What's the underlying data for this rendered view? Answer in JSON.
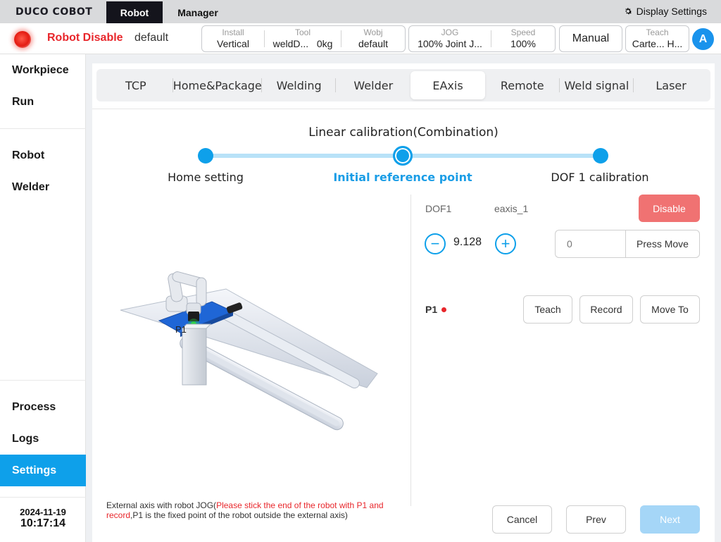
{
  "topbar": {
    "logo": "DUCO COBOT",
    "tabs": [
      "Robot",
      "Manager"
    ],
    "display_settings": "Display Settings"
  },
  "status": {
    "robot_state": "Robot Disable",
    "robot_name": "default",
    "install": {
      "label": "Install",
      "value": "Vertical"
    },
    "tool": {
      "label": "Tool",
      "value": "weldD...",
      "load": "0kg"
    },
    "wobj": {
      "label": "Wobj",
      "value": "default"
    },
    "jog": {
      "label": "JOG",
      "value": "100% Joint J..."
    },
    "speed": {
      "label": "Speed",
      "value": "100%"
    },
    "mode": "Manual",
    "teach": {
      "label": "Teach",
      "value": "Carte... H..."
    },
    "avatar": "A",
    "led_color": "#e41b12"
  },
  "sidebar": {
    "items": [
      "Workpiece",
      "Run",
      "Robot",
      "Welder",
      "Process",
      "Logs",
      "Settings"
    ],
    "active": "Settings",
    "date": "2024-11-19",
    "time": "10:17:14"
  },
  "tabs": [
    "TCP",
    "Home&Package",
    "Welding",
    "Welder",
    "EAxis",
    "Remote",
    "Weld signal",
    "Laser"
  ],
  "active_tab": "EAxis",
  "calibration": {
    "title": "Linear calibration(Combination)",
    "steps": [
      "Home setting",
      "Initial reference point",
      "DOF 1 calibration"
    ],
    "current_step": 1
  },
  "illustration": {
    "point_label": "P1"
  },
  "panel": {
    "dof_label": "DOF1",
    "axis_name": "eaxis_1",
    "disable_label": "Disable",
    "value": "9.128",
    "move_input": "0",
    "press_move_label": "Press Move",
    "p1_label": "P1",
    "teach_label": "Teach",
    "record_label": "Record",
    "move_to_label": "Move To"
  },
  "footer": {
    "note_prefix": "External axis with robot JOG(",
    "note_red": "Please stick the end of the robot with P1 and record",
    "note_suffix": ",P1 is the fixed point of the robot outside the external axis)",
    "cancel": "Cancel",
    "prev": "Prev",
    "next": "Next"
  },
  "colors": {
    "accent": "#0ea0ea",
    "danger": "#f07272",
    "disabled_next": "#a5d6f7"
  }
}
